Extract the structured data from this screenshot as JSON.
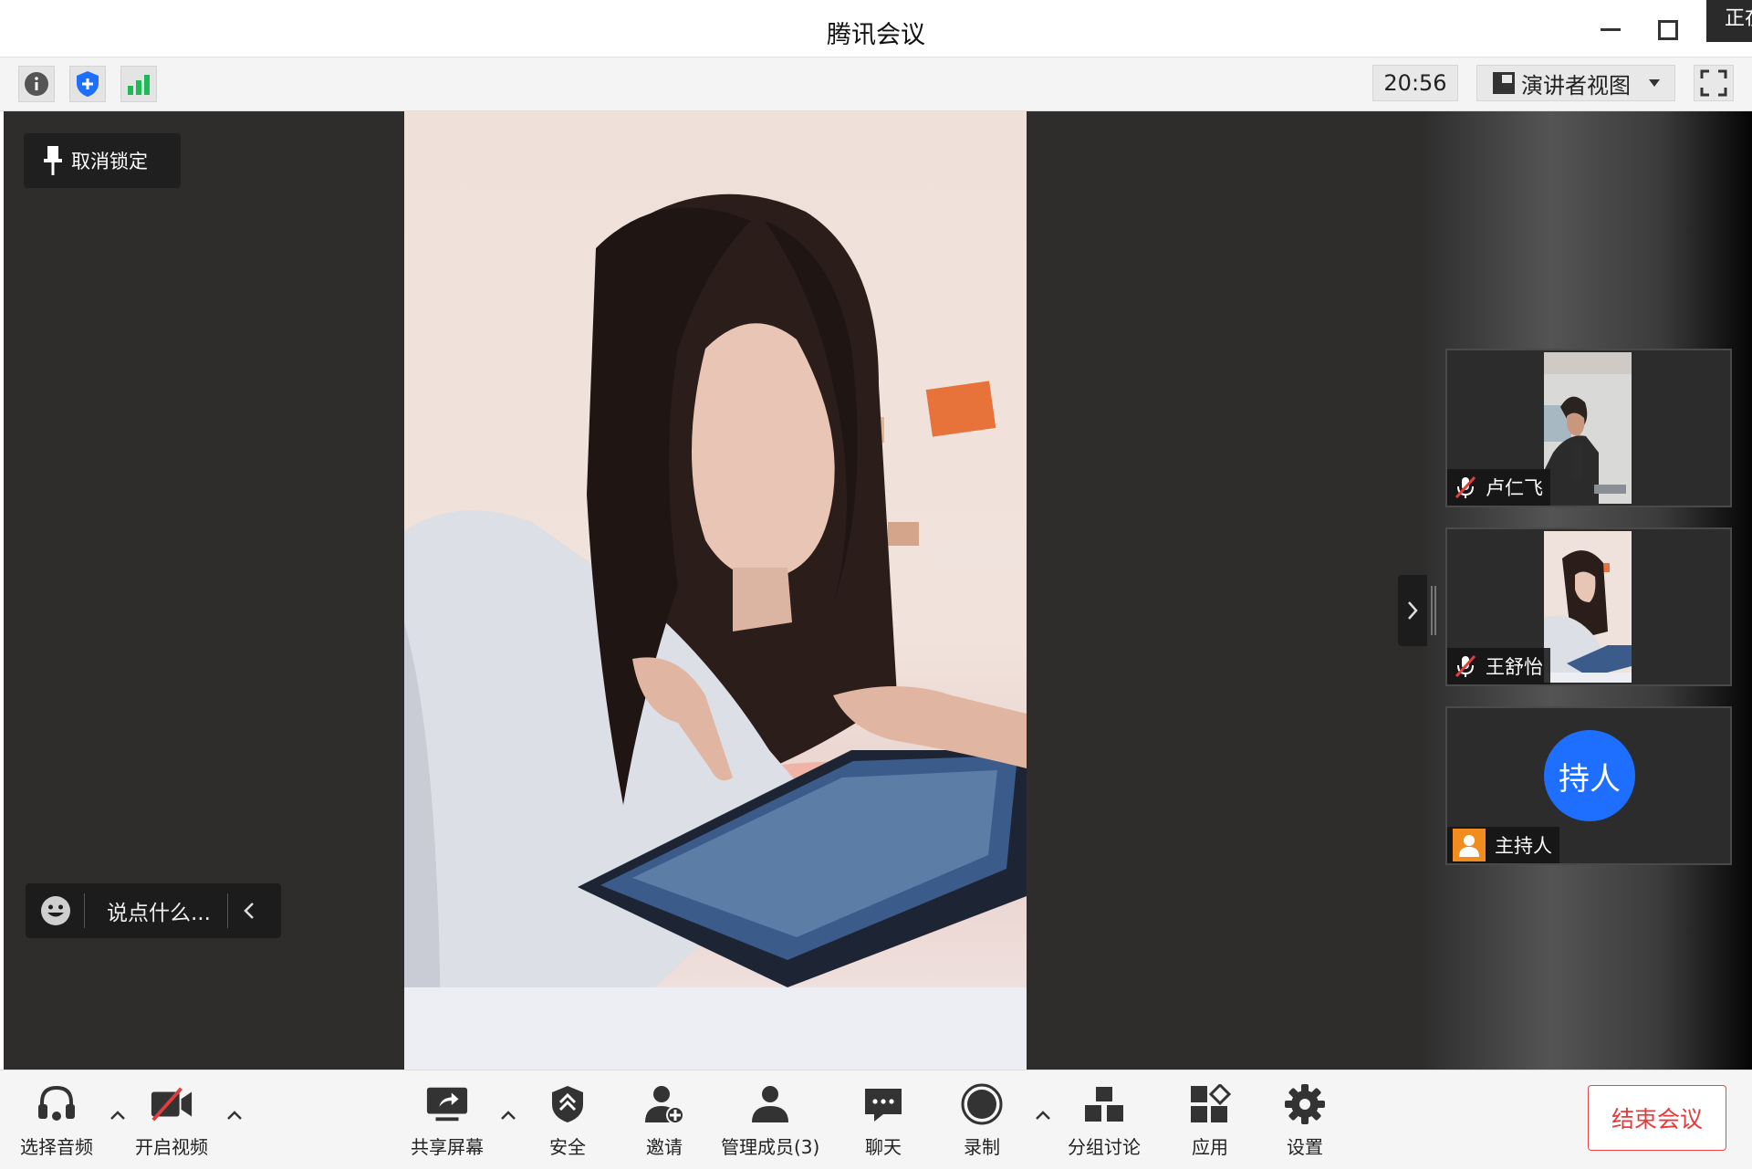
{
  "window": {
    "title": "腾讯会议",
    "corner_badge": "正在"
  },
  "infobar": {
    "time": "20:56",
    "view_label": "演讲者视图"
  },
  "stage": {
    "unpin_label": "取消锁定",
    "chat_placeholder": "说点什么..."
  },
  "participants": [
    {
      "name": "卢仁飞",
      "muted": true
    },
    {
      "name": "王舒怡",
      "muted": true
    },
    {
      "name": "主持人",
      "avatar_text": "持人",
      "role": "host"
    }
  ],
  "toolbar": {
    "audio": "选择音频",
    "video": "开启视频",
    "share": "共享屏幕",
    "security": "安全",
    "invite": "邀请",
    "members": "管理成员(3)",
    "chat": "聊天",
    "record": "录制",
    "breakout": "分组讨论",
    "apps": "应用",
    "settings": "设置",
    "end": "结束会议"
  },
  "colors": {
    "accent": "#1e6fff",
    "end_meeting": "#e43c3c",
    "stage_bg": "#2e2d2b",
    "host_icon": "#f28c1f",
    "signal": "#1fb957"
  }
}
